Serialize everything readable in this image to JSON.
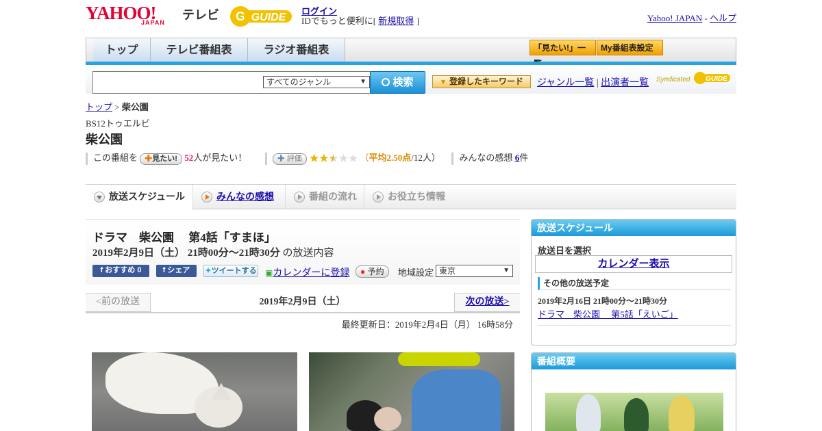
{
  "header": {
    "logo_yahoo": "YAHOO!",
    "logo_japan": "JAPAN",
    "logo_tv": "テレビ",
    "gguide_text": "GUIDE",
    "login": "ログイン",
    "login_prefix": "IDでもっと便利に[",
    "signup": "新規取得",
    "login_suffix": "]",
    "yahoo_japan_link": "Yahoo! JAPAN",
    "separator": "-",
    "help_link": "ヘルプ"
  },
  "nav": {
    "tabs": [
      "トップ",
      "テレビ番組表",
      "ラジオ番組表"
    ],
    "buttons": [
      "「見たい!」一覧",
      "My番組表設定"
    ]
  },
  "search": {
    "genre_select": "すべてのジャンル",
    "button": "検索",
    "keyword_button": "登録したキーワード",
    "genre_list": "ジャンル一覧",
    "cast_list": "出演者一覧",
    "divider": "|",
    "syndicated": "Syndicated"
  },
  "breadcrumb": {
    "top": "トップ",
    "separator": ">",
    "current": "柴公園"
  },
  "program": {
    "station": "BS12トゥエルビ",
    "title": "柴公園",
    "want_prefix": "この番組を",
    "want_button": "見たい!",
    "want_count": "52",
    "want_suffix": "人が見たい！",
    "rate_button": "評価",
    "rating": 2.5,
    "avg_prefix": "（",
    "avg_label": "平均2.50点",
    "avg_suffix": "/12人）",
    "impressions_label": "みんなの感想",
    "impressions_count": "6",
    "impressions_suffix": "件"
  },
  "tabs": [
    {
      "label": "放送スケジュール",
      "active": true
    },
    {
      "label": "みんなの感想",
      "link": true
    },
    {
      "label": "番組の流れ"
    },
    {
      "label": "お役立ち情報"
    }
  ],
  "episode": {
    "title": "ドラマ　柴公園　 第4話「すまほ」",
    "datetime": "2019年2月9日（土） 21時00分～21時30分",
    "datetime_suffix": "の放送内容",
    "fb_recommend": "おすすめ 0",
    "fb_share": "シェア",
    "tweet": "ツイートする",
    "calendar": "カレンダーに登録",
    "reserve": "予約",
    "region_label": "地域設定",
    "region_value": "東京",
    "prev": "<前の放送",
    "current_date": "2019年2月9日（土）",
    "next": "次の放送>",
    "updated": "最終更新日：2019年2月4日（月） 16時58分"
  },
  "sidebar": {
    "schedule_heading": "放送スケジュール",
    "select_date": "放送日を選択",
    "calendar_button": "カレンダー表示",
    "other_heading": "その他の放送予定",
    "other_datetime": "2019年2月16日 21時00分～21時30分",
    "other_link": "ドラマ　柴公園　 第5話「えいご」",
    "summary_heading": "番組概要"
  },
  "colors": {
    "brand_red": "#e60033",
    "accent_blue": "#29a3e0",
    "link": "#1a0dab"
  }
}
